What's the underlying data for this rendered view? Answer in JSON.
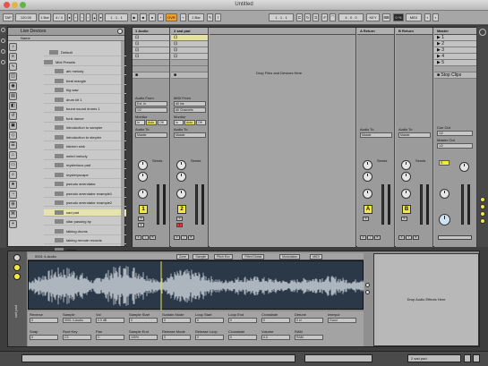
{
  "window": {
    "title": "Untitled"
  },
  "control_bar": {
    "tap": "TAP",
    "tempo": "120.00",
    "bars_a": "1 Bar",
    "time_sig": "4 / 4",
    "ovr": "OVR",
    "position": "1 . 1 . 1",
    "loop_len": "4 . 0 . 0",
    "key": "KEY",
    "cpu": "0 %",
    "midi": "MIDI"
  },
  "browser": {
    "title": "Live Devices",
    "column": "Name",
    "items": [
      {
        "label": "Default",
        "indent": 2,
        "kind": "folder"
      },
      {
        "label": "Midi Presets",
        "indent": 1,
        "kind": "folder"
      },
      {
        "label": "afx melody",
        "indent": 3,
        "kind": "file"
      },
      {
        "label": "beat mangle",
        "indent": 3,
        "kind": "file"
      },
      {
        "label": "big saw",
        "indent": 3,
        "kind": "file"
      },
      {
        "label": "drum kit 1",
        "indent": 3,
        "kind": "file"
      },
      {
        "label": "found sound drums 1",
        "indent": 3,
        "kind": "file"
      },
      {
        "label": "funk dance",
        "indent": 3,
        "kind": "file"
      },
      {
        "label": "introduction to sampler",
        "indent": 3,
        "kind": "file"
      },
      {
        "label": "introduction to simpler",
        "indent": 3,
        "kind": "file"
      },
      {
        "label": "kitchen sink",
        "indent": 3,
        "kind": "file"
      },
      {
        "label": "weird melody",
        "indent": 3,
        "kind": "file"
      },
      {
        "label": "mysterious pad",
        "indent": 3,
        "kind": "file"
      },
      {
        "label": "mysteryscape",
        "indent": 3,
        "kind": "file"
      },
      {
        "label": "pseudo arrendator",
        "indent": 3,
        "kind": "file"
      },
      {
        "label": "pseudo arrendator example1",
        "indent": 3,
        "kind": "file"
      },
      {
        "label": "pseudo arrendator example2",
        "indent": 3,
        "kind": "file"
      },
      {
        "label": "sad pad",
        "indent": 3,
        "kind": "file",
        "selected": true
      },
      {
        "label": "sitar passing by",
        "indent": 3,
        "kind": "file"
      },
      {
        "label": "talking drums",
        "indent": 3,
        "kind": "file"
      },
      {
        "label": "talking remote records",
        "indent": 3,
        "kind": "file"
      },
      {
        "label": "whiner",
        "indent": 3,
        "kind": "file"
      }
    ]
  },
  "session": {
    "drop_hint": "Drop Files and Devices Here",
    "stop_clips": "Stop Clips",
    "tracks": [
      {
        "name": "1 Audio",
        "number": "1",
        "audio_from_label": "Audio From",
        "audio_from": "Ext. In",
        "input_channel": "1/2",
        "monitor_label": "Monitor",
        "audio_to_label": "Audio To",
        "audio_to": "Master",
        "sends_label": "Sends"
      },
      {
        "name": "2 sad pad",
        "number": "2",
        "audio_from_label": "MIDI From",
        "audio_from": "All Ins",
        "input_channel": "All Channels",
        "monitor_label": "Monitor",
        "audio_to_label": "Audio To",
        "audio_to": "Master",
        "sends_label": "Sends"
      },
      {
        "name": "A Return",
        "number": "A",
        "audio_to_label": "Audio To",
        "audio_to": "Master",
        "sends_label": "Sends"
      },
      {
        "name": "B Return",
        "number": "B",
        "audio_to_label": "Audio To",
        "audio_to": "Master",
        "sends_label": "Sends"
      },
      {
        "name": "Master",
        "number": "0",
        "cue_out_label": "Cue Out",
        "cue_out": "1/2",
        "master_out_label": "Master Out",
        "master_out": "1/2"
      }
    ],
    "master_scenes": [
      "1",
      "2",
      "3",
      "4",
      "5"
    ],
    "monitor_options": [
      "In",
      "Auto",
      "Off"
    ]
  },
  "clip_view": {
    "clip_name": "0001 4-Audio",
    "tabs": [
      "Zone",
      "Sample",
      "Pitch Env",
      "Filter/Global",
      "Modulation",
      "MIDI"
    ],
    "side_label": "sad pad",
    "fx_hint": "Drop Audio Effects Here",
    "controls": [
      {
        "label": "Reverse",
        "value": "0"
      },
      {
        "label": "Sample",
        "value": "0001 4-Audio"
      },
      {
        "label": "Vol",
        "value": "0.0 dB"
      },
      {
        "label": "Sample Start",
        "value": "0"
      },
      {
        "label": "Sustain Mode",
        "value": "0"
      },
      {
        "label": "Loop Start",
        "value": "0"
      },
      {
        "label": "Loop End",
        "value": "0"
      },
      {
        "label": "Crossfade",
        "value": "0"
      },
      {
        "label": "Detune",
        "value": "0 ct"
      },
      {
        "label": "Interpol",
        "value": "Good"
      },
      {
        "label": "Snap",
        "value": "0"
      },
      {
        "label": "Root Key",
        "value": "C3"
      },
      {
        "label": "Pan",
        "value": "C"
      },
      {
        "label": "Sample End",
        "value": "100%"
      },
      {
        "label": "Release Mode",
        "value": "0"
      },
      {
        "label": "Release Loop",
        "value": "0"
      },
      {
        "label": "Crossfade",
        "value": "0"
      },
      {
        "label": "Volume",
        "value": "0.0"
      },
      {
        "label": "RAM",
        "value": "RAM"
      }
    ]
  },
  "status": {
    "message": "",
    "track_name": "2 sad pad"
  }
}
